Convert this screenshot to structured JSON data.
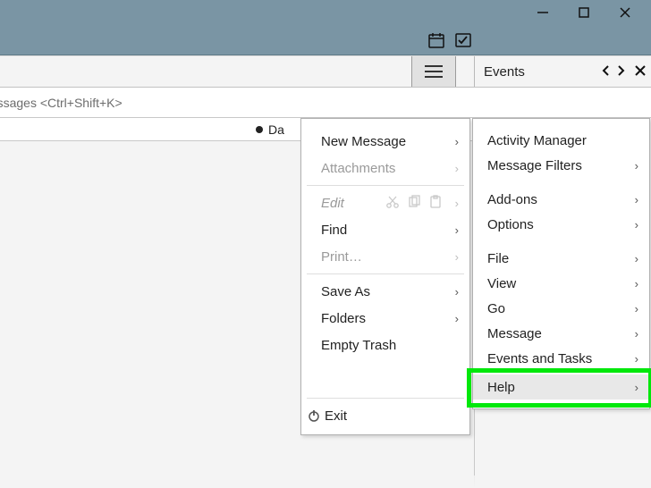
{
  "window_controls": {
    "min": "minimize",
    "max": "maximize",
    "close": "close"
  },
  "iconbar": {
    "calendar": "calendar-icon",
    "tasks": "tasks-icon"
  },
  "events_header": {
    "title": "Events"
  },
  "filter_hint": "Filter these messages <Ctrl+Shift+K>",
  "column_label": "Da",
  "left_menu": {
    "new_message": "New Message",
    "attachments": "Attachments",
    "edit": "Edit",
    "find": "Find",
    "print": "Print…",
    "save_as": "Save As",
    "folders": "Folders",
    "empty_trash": "Empty Trash",
    "exit": "Exit"
  },
  "right_menu": {
    "activity": "Activity Manager",
    "filters": "Message Filters",
    "addons": "Add-ons",
    "options": "Options",
    "file": "File",
    "view": "View",
    "go": "Go",
    "message": "Message",
    "events_tasks": "Events and Tasks",
    "help": "Help"
  }
}
